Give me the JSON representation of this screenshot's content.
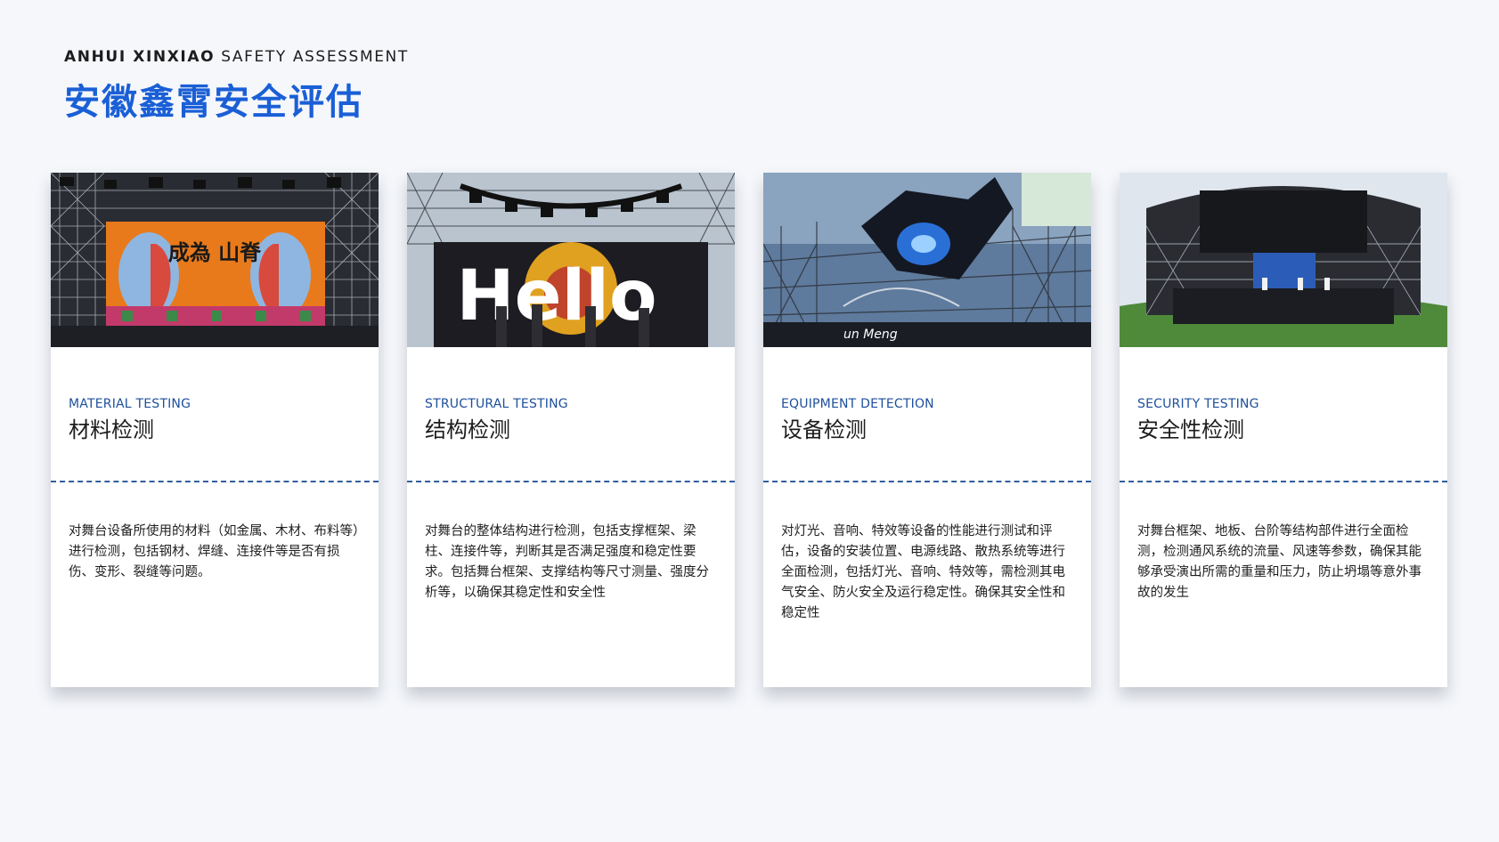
{
  "header": {
    "subtitle_bold": "ANHUI XINXIAO",
    "subtitle_rest": "SAFETY ASSESSMENT",
    "title": "安徽鑫霄安全评估"
  },
  "cards": [
    {
      "photo": "stage-photo",
      "photo_text": "成為 山脊",
      "en": "MATERIAL TESTING",
      "cn": "材料检测",
      "body": "对舞台设备所使用的材料（如金属、木材、布料等）进行检测，包括钢材、焊缝、连接件等是否有损伤、变形、裂缝等问题。"
    },
    {
      "photo": "stage-photo",
      "photo_text": "Hello",
      "en": "STRUCTURAL TESTING",
      "cn": "结构检测",
      "body": "对舞台的整体结构进行检测，包括支撑框架、梁柱、连接件等，判断其是否满足强度和稳定性要求。包括舞台框架、支撑结构等尺寸测量、强度分析等，以确保其稳定性和安全性"
    },
    {
      "photo": "stage-photo",
      "photo_text": "un Meng",
      "en": "EQUIPMENT DETECTION",
      "cn": "设备检测",
      "body": "对灯光、音响、特效等设备的性能进行测试和评估，设备的安装位置、电源线路、散热系统等进行全面检测，包括灯光、音响、特效等，需检测其电气安全、防火安全及运行稳定性。确保其安全性和稳定性"
    },
    {
      "photo": "stage-photo",
      "photo_text": "",
      "en": "SECURITY TESTING",
      "cn": "安全性检测",
      "body": "对舞台框架、地板、台阶等结构部件进行全面检测，检测通风系统的流量、风速等参数，确保其能够承受演出所需的重量和压力，防止坍塌等意外事故的发生"
    }
  ]
}
